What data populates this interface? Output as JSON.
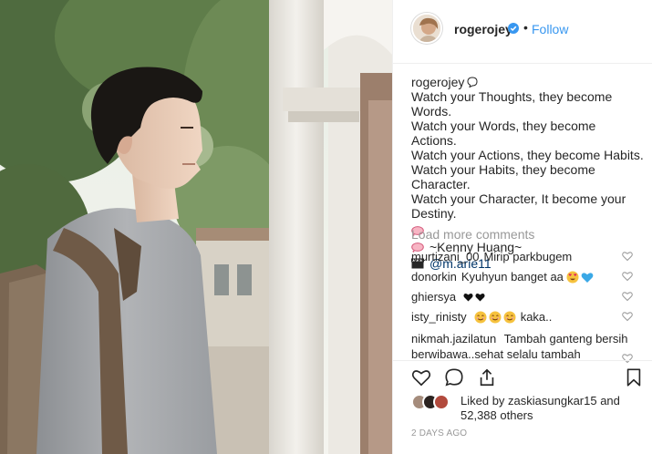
{
  "post": {
    "username": "rogerojey",
    "follow_label": "Follow",
    "separator": "•"
  },
  "caption": {
    "username": "rogerojey",
    "lines": [
      "Watch your Thoughts, they become Words.",
      "Watch your Words, they become Actions.",
      "Watch your Actions, they become Habits.",
      "Watch your Habits, they become Character.",
      "Watch your Character, It become your",
      "Destiny."
    ],
    "author_line": "~Kenny Huang~",
    "credit_mention": "@m.arie11"
  },
  "comments": {
    "load_more_label": "Load more comments",
    "items": [
      {
        "user": "murtizani_00",
        "text": "Mirip parkbugem"
      },
      {
        "user": "donorkin",
        "text": "Kyuhyun banget aa"
      },
      {
        "user": "ghiersya",
        "text": ""
      },
      {
        "user": "isty_rinisty",
        "text": "kaka.."
      },
      {
        "user": "nikmah.jazilatun",
        "text": "Tambah ganteng bersih berwibawa..sehat selalu tambah"
      }
    ]
  },
  "likes": {
    "line1": "Liked by zaskiasungkar15 and",
    "line2": "52,388 others"
  },
  "date": "2 DAYS AGO",
  "icons": {
    "verified": "verified-badge-icon",
    "like": "heart-outline-icon",
    "comment": "comment-bubble-icon",
    "share": "share-upload-icon",
    "save": "bookmark-icon"
  },
  "colors": {
    "link": "#3897f0",
    "muted": "#999999",
    "text": "#262626",
    "border": "#efefef",
    "verified": "#3897f0",
    "heart_red": "#ed4956"
  }
}
